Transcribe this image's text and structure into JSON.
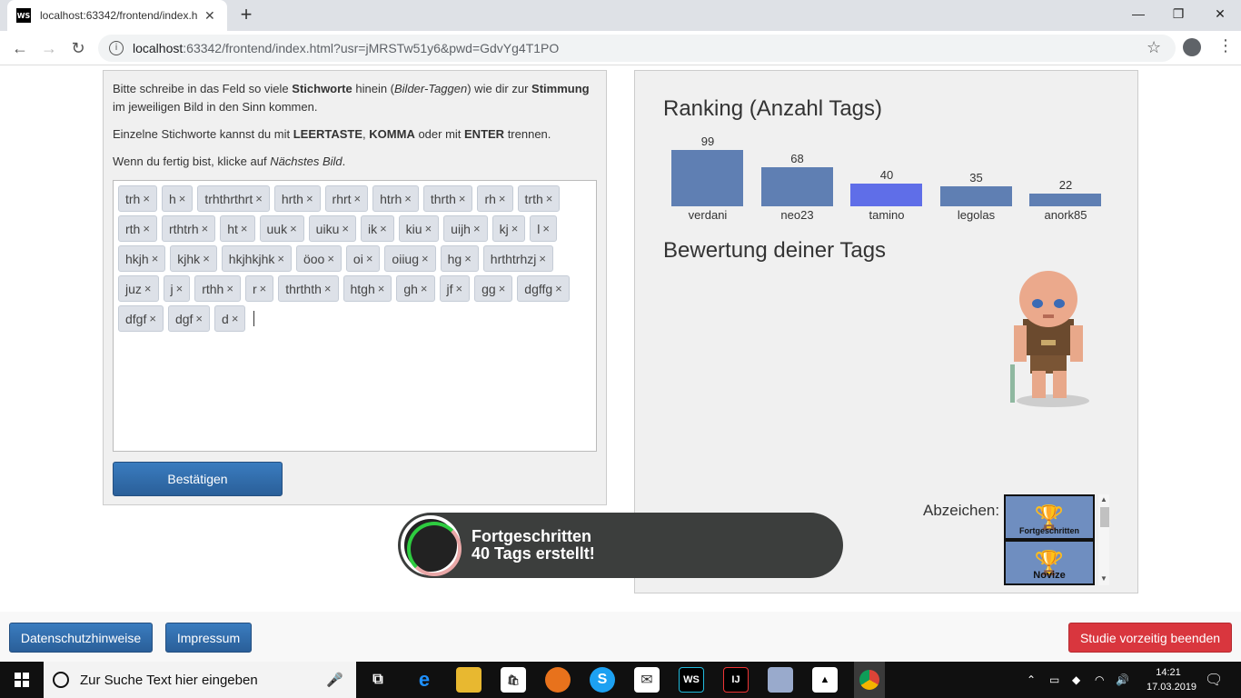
{
  "browser": {
    "tab_title": "localhost:63342/frontend/index.h",
    "url_host": "localhost",
    "url_rest": ":63342/frontend/index.html?usr=jMRSTw51y6&pwd=GdvYg4T1PO"
  },
  "instructions": {
    "p1": [
      "Bitte schreibe in das Feld so viele ",
      "Stichworte",
      " hinein (",
      "Bilder-Taggen",
      ") wie dir zur ",
      "Stimmung",
      " im jeweiligen Bild in den Sinn kommen."
    ],
    "p2": [
      "Einzelne Stichworte kannst du mit ",
      "LEERTASTE",
      ", ",
      "KOMMA",
      " oder mit ",
      "ENTER",
      " trennen."
    ],
    "p3": [
      "Wenn du fertig bist, klicke auf ",
      "Nächstes Bild",
      "."
    ]
  },
  "tags": [
    "trh",
    "h",
    "trhthrthrt",
    "hrth",
    "rhrt",
    "htrh",
    "thrth",
    "rh",
    "trth",
    "rth",
    "rthtrh",
    "ht",
    "uuk",
    "uiku",
    "ik",
    "kiu",
    "uijh",
    "kj",
    "l",
    "hkjh",
    "kjhk",
    "hkjhkjhk",
    "öoo",
    "oi",
    "oiiug",
    "hg",
    "hrthtrhzj",
    "juz",
    "j",
    "rthh",
    "r",
    "thrthth",
    "htgh",
    "gh",
    "jf",
    "gg",
    "dgffg",
    "dfgf",
    "dgf",
    "d"
  ],
  "tag_remove_symbol": "×",
  "confirm_label": "Bestätigen",
  "ranking": {
    "title": "Ranking (Anzahl Tags)"
  },
  "chart_data": {
    "type": "bar",
    "title": "Ranking (Anzahl Tags)",
    "categories": [
      "verdani",
      "neo23",
      "tamino",
      "legolas",
      "anork85"
    ],
    "values": [
      99,
      68,
      40,
      35,
      22
    ],
    "colors": [
      "#5f7fb3",
      "#5f7fb3",
      "#5f6ee8",
      "#5f7fb3",
      "#5f7fb3"
    ],
    "highlight": "tamino",
    "ylim": [
      0,
      100
    ]
  },
  "rating_title": "Bewertung deiner Tags",
  "badges": {
    "label": "Abzeichen:",
    "items": [
      {
        "name": "Fortgeschritten",
        "color": "#1a1aa8"
      },
      {
        "name": "Novize",
        "color": "#1e8a1e"
      }
    ]
  },
  "toast": {
    "line1": "Fortgeschritten",
    "line2": "40 Tags erstellt!"
  },
  "footer": {
    "privacy": "Datenschutzhinweise",
    "imprint": "Impressum",
    "end_study": "Studie vorzeitig beenden"
  },
  "taskbar": {
    "search_placeholder": "Zur Suche Text hier eingeben",
    "time": "14:21",
    "date": "17.03.2019"
  }
}
